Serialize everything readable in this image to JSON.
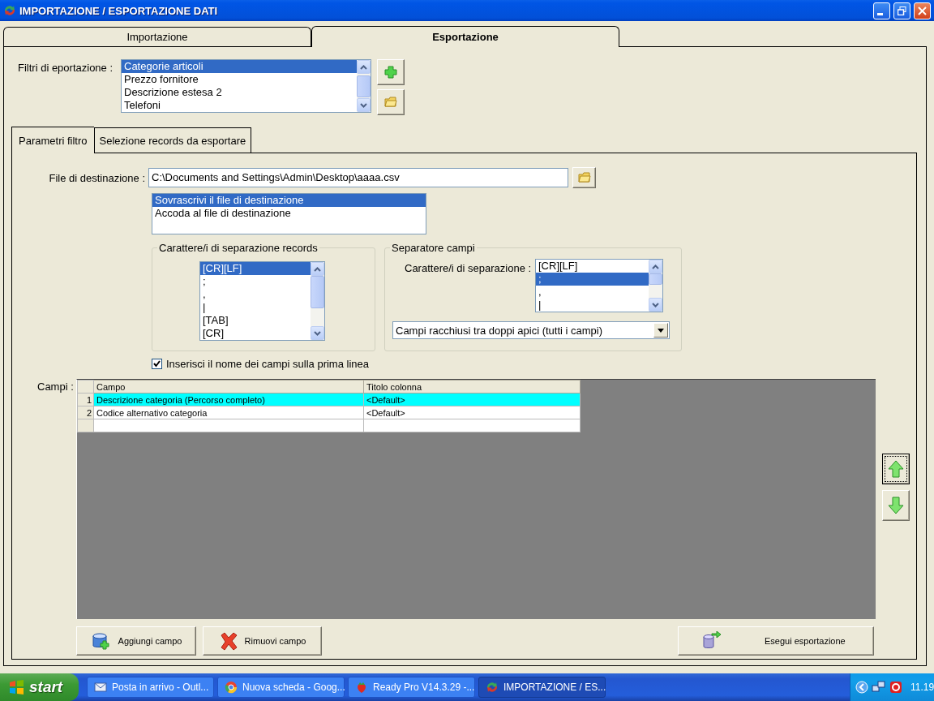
{
  "window": {
    "title": "IMPORTAZIONE / ESPORTAZIONE DATI"
  },
  "main_tabs": [
    {
      "label": "Importazione",
      "selected": false
    },
    {
      "label": "Esportazione",
      "selected": true
    }
  ],
  "export_filters": {
    "label": "Filtri di eportazione :",
    "items": [
      {
        "label": "Categorie articoli",
        "selected": true
      },
      {
        "label": "Prezzo fornitore",
        "selected": false
      },
      {
        "label": "Descrizione estesa 2",
        "selected": false
      },
      {
        "label": "Telefoni",
        "selected": false
      }
    ]
  },
  "sub_tabs": [
    {
      "label": "Parametri filtro",
      "selected": true
    },
    {
      "label": "Selezione records da esportare",
      "selected": false
    }
  ],
  "destination": {
    "label": "File di destinazione :",
    "value": "C:\\Documents and Settings\\Admin\\Desktop\\aaaa.csv"
  },
  "write_mode": [
    {
      "label": "Sovrascrivi il file di destinazione",
      "selected": true
    },
    {
      "label": "Accoda al file di destinazione",
      "selected": false
    }
  ],
  "record_separator": {
    "title": "Carattere/i di separazione records",
    "items": [
      {
        "label": "[CR][LF]",
        "selected": true
      },
      {
        "label": ";",
        "selected": false
      },
      {
        "label": ",",
        "selected": false
      },
      {
        "label": "|",
        "selected": false
      },
      {
        "label": "[TAB]",
        "selected": false
      },
      {
        "label": "[CR]",
        "selected": false
      }
    ]
  },
  "field_separator": {
    "title": "Separatore campi",
    "label": "Carattere/i di separazione :",
    "items": [
      {
        "label": "[CR][LF]",
        "selected": false
      },
      {
        "label": ";",
        "selected": true
      },
      {
        "label": ",",
        "selected": false
      },
      {
        "label": "|",
        "selected": false
      }
    ],
    "quoting": "Campi racchiusi tra doppi apici (tutti i campi)"
  },
  "header_checkbox": {
    "label": "Inserisci il nome dei campi sulla prima linea",
    "checked": true
  },
  "fields": {
    "label": "Campi :",
    "columns": [
      "Campo",
      "Titolo colonna"
    ],
    "rows": [
      {
        "number": "1",
        "field": "Descrizione categoria (Percorso completo)",
        "title": "<Default>",
        "selected": true
      },
      {
        "number": "2",
        "field": "Codice alternativo categoria",
        "title": "<Default>",
        "selected": false
      }
    ]
  },
  "buttons": [
    {
      "label": "Aggiungi campo",
      "kind": "add"
    },
    {
      "label": "Rimuovi campo",
      "kind": "remove"
    },
    {
      "label": "Esegui esportazione",
      "kind": "export"
    }
  ],
  "taskbar": {
    "start": "start",
    "tasks": [
      {
        "label": "Posta in arrivo - Outl...",
        "kind": "mail",
        "selected": false
      },
      {
        "label": "Nuova scheda - Goog...",
        "kind": "browser",
        "selected": false
      },
      {
        "label": "Ready Pro V14.3.29 -...",
        "kind": "strawberry",
        "selected": false
      },
      {
        "label": "IMPORTAZIONE / ES...",
        "kind": "arrows",
        "selected": true
      }
    ],
    "clock": "11.19"
  }
}
